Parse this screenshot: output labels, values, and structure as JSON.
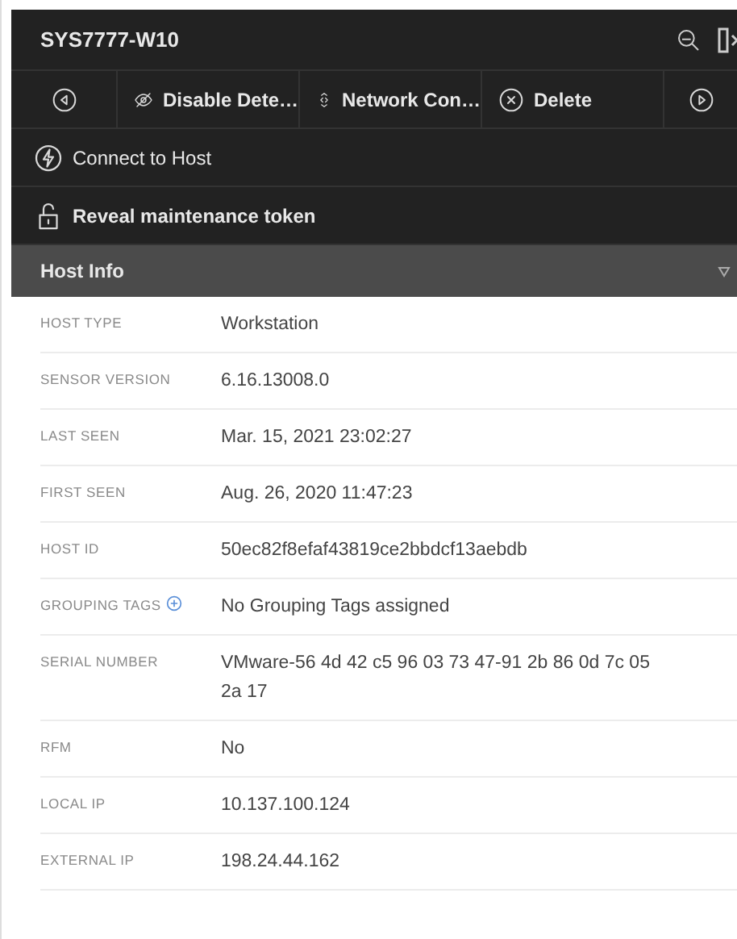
{
  "window": {
    "title": "SYS7777-W10"
  },
  "toolbar": [
    {
      "kind": "prev"
    },
    {
      "kind": "disable",
      "label": "Disable Dete…"
    },
    {
      "kind": "network",
      "label": "Network Con…"
    },
    {
      "kind": "delete",
      "label": "Delete"
    },
    {
      "kind": "next"
    }
  ],
  "actions": [
    {
      "kind": "connect",
      "label": "Connect to Host",
      "bold": false
    },
    {
      "kind": "reveal",
      "label": "Reveal maintenance token",
      "bold": true
    }
  ],
  "section": {
    "title": "Host Info"
  },
  "rows": [
    {
      "label": "HOST TYPE",
      "value": "Workstation"
    },
    {
      "label": "SENSOR VERSION",
      "value": "6.16.13008.0"
    },
    {
      "label": "LAST SEEN",
      "value": "Mar. 15, 2021 23:02:27"
    },
    {
      "label": "FIRST SEEN",
      "value": "Aug. 26, 2020 11:47:23"
    },
    {
      "label": "HOST ID",
      "value": "50ec82f8efaf43819ce2bbdcf13aebdb"
    },
    {
      "label": "GROUPING TAGS",
      "value": "No Grouping Tags assigned",
      "add": true
    },
    {
      "label": "SERIAL NUMBER",
      "value": "VMware-56 4d 42 c5 96 03 73 47-91 2b 86 0d 7c 05 2a 17"
    },
    {
      "label": "RFM",
      "value": "No"
    },
    {
      "label": "LOCAL IP",
      "value": "10.137.100.124"
    },
    {
      "label": "EXTERNAL IP",
      "value": "198.24.44.162"
    }
  ]
}
